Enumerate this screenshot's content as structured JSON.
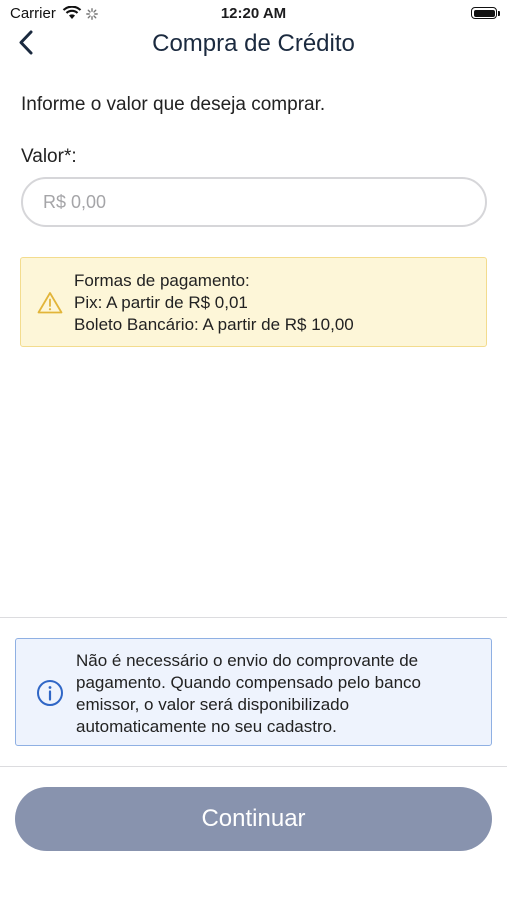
{
  "status_bar": {
    "carrier": "Carrier",
    "time": "12:20 AM"
  },
  "nav": {
    "title": "Compra de Crédito"
  },
  "form": {
    "instruction": "Informe o valor que deseja comprar.",
    "valor_label": "Valor*:",
    "valor_placeholder": "R$ 0,00",
    "valor_value": ""
  },
  "payment_warning": {
    "line1": "Formas de pagamento:",
    "line2": "Pix: A partir de R$ 0,01",
    "line3": "Boleto Bancário: A partir de R$ 10,00"
  },
  "info_notice": {
    "text": "Não é necessário o envio do comprovante de pagamento. Quando compensado pelo banco emissor, o valor será disponibilizado automaticamente no seu cadastro."
  },
  "actions": {
    "continue_label": "Continuar"
  },
  "colors": {
    "primary_navy": "#1b2a3f",
    "disabled_button": "#8893ae",
    "warning_bg": "#fdf6d8",
    "warning_icon": "#e2b53a",
    "info_bg": "#eef3fd",
    "info_icon": "#2f66c6"
  },
  "icons": {
    "back": "chevron-left-icon",
    "warning": "warning-triangle-icon",
    "info": "info-circle-icon"
  }
}
